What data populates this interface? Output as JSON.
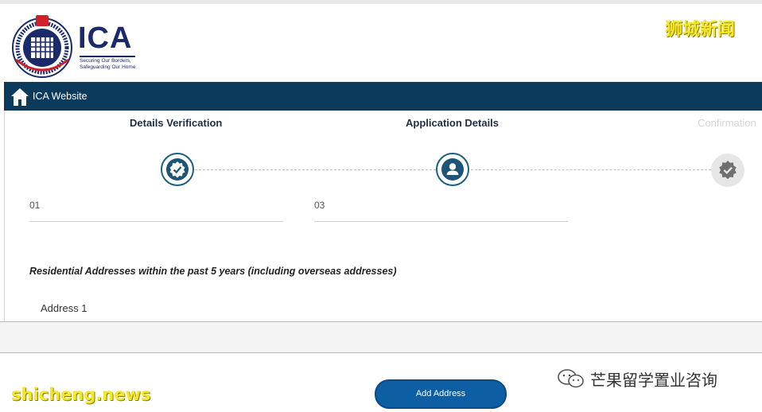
{
  "header": {
    "logo_word": "ICA",
    "tagline_line1": "Securing Our Borders,",
    "tagline_line2": "Safeguarding Our Home"
  },
  "watermarks": {
    "top_right": "狮城新闻",
    "bottom_left": "shicheng.news",
    "bottom_right": "芒果留学置业咨询"
  },
  "nav": {
    "home_icon": "home-icon",
    "link_label": "ICA Website"
  },
  "steps": [
    {
      "title": "Details Verification",
      "icon": "verified-badge-icon",
      "state": "completed"
    },
    {
      "title": "Application Details",
      "icon": "user-icon",
      "state": "active"
    },
    {
      "title": "Confirmation",
      "icon": "verified-badge-icon",
      "state": "inactive"
    }
  ],
  "fields": [
    {
      "value": "01"
    },
    {
      "value": "03"
    }
  ],
  "section": {
    "heading": "Residential Addresses within the past 5 years (including overseas addresses)",
    "address_label": "Address 1"
  },
  "actions": {
    "add_address_label": "Add Address"
  },
  "colors": {
    "nav_bg": "#0b3a5c",
    "accent": "#1d5577",
    "button": "#0e5ea3",
    "watermark": "#f4e629"
  }
}
